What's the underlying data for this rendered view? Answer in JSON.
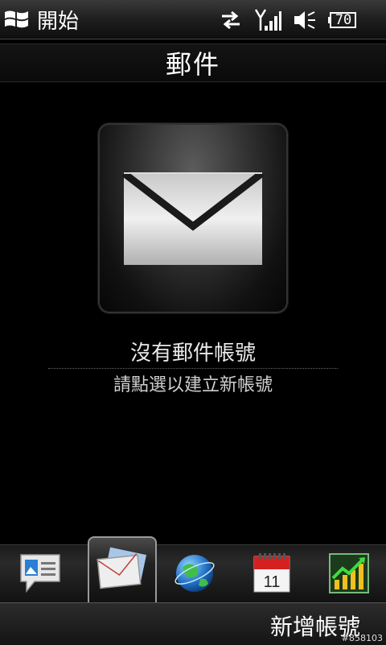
{
  "status_bar": {
    "start_label": "開始",
    "battery_level": "70"
  },
  "title": "郵件",
  "main": {
    "empty_message": "沒有郵件帳號",
    "hint_message": "請點選以建立新帳號"
  },
  "tabs": [
    {
      "icon": "messaging-icon",
      "active": false
    },
    {
      "icon": "mail-icon",
      "active": true
    },
    {
      "icon": "internet-globe-icon",
      "active": false
    },
    {
      "icon": "calendar-icon",
      "active": false,
      "calendar_day": "11"
    },
    {
      "icon": "stocks-icon",
      "active": false
    }
  ],
  "softkeys": {
    "right": "新增帳號"
  },
  "watermark": "#858103",
  "colors": {
    "background": "#000000",
    "calendar_red": "#d42020",
    "stocks_green": "#2e8b2e"
  }
}
